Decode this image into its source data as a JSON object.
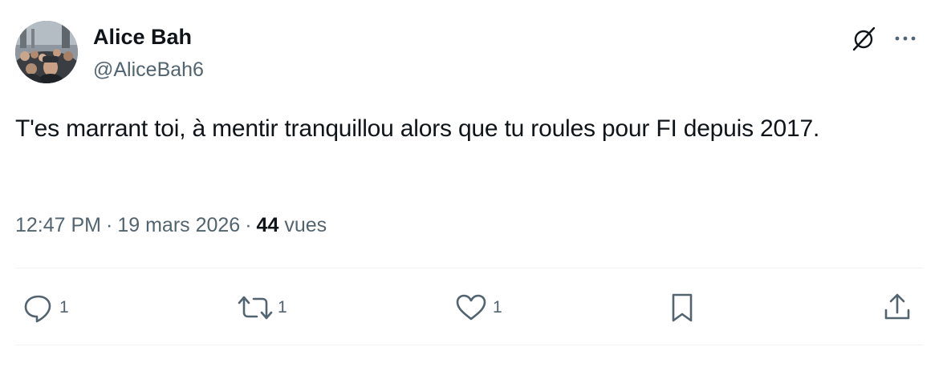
{
  "author": {
    "display_name": "Alice Bah",
    "handle": "@AliceBah6"
  },
  "tweet": {
    "text": "T'es marrant toi, à mentir tranquillou alors que tu roules pour FI depuis 2017.",
    "time": "12:47 PM",
    "date": "19 mars 2026",
    "views_count": "44",
    "views_label": "vues",
    "separator": "·"
  },
  "actions": {
    "reply_count": "1",
    "repost_count": "1",
    "like_count": "1"
  },
  "icons": {
    "top_right": [
      "grok-icon",
      "more-icon"
    ],
    "bar": [
      "reply-icon",
      "repost-icon",
      "like-icon",
      "bookmark-icon",
      "share-icon"
    ]
  },
  "colors": {
    "text_primary": "#0f1419",
    "text_secondary": "#536471",
    "divider": "#eff3f4"
  }
}
